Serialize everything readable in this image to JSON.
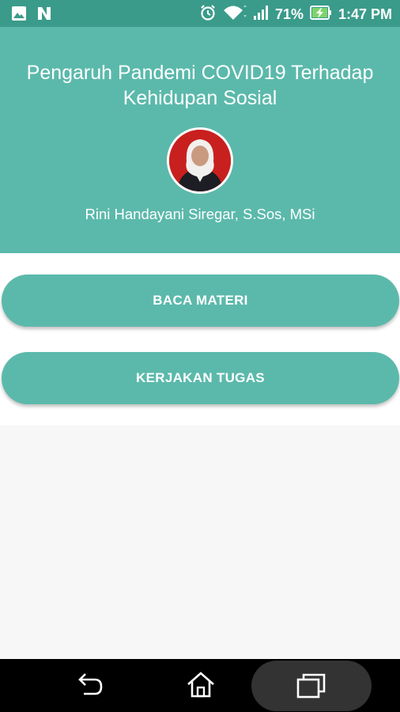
{
  "status_bar": {
    "battery": "71%",
    "time": "1:47 PM",
    "icons": [
      "image-icon",
      "n-icon",
      "alarm-icon",
      "wifi-icon",
      "signal-icon",
      "battery-charging-icon"
    ]
  },
  "header": {
    "title_line1": "Pengaruh Pandemi COVID19 Terhadap",
    "title_line2": "Kehidupan Sosial",
    "author": "Rini Handayani Siregar, S.Sos, MSi"
  },
  "buttons": {
    "read": "BACA MATERI",
    "task": "KERJAKAN TUGAS"
  },
  "nav": {
    "icons": [
      "back-icon",
      "home-icon",
      "recents-icon"
    ]
  },
  "colors": {
    "primary": "#5bb9ab",
    "status": "#3a9b8b"
  }
}
